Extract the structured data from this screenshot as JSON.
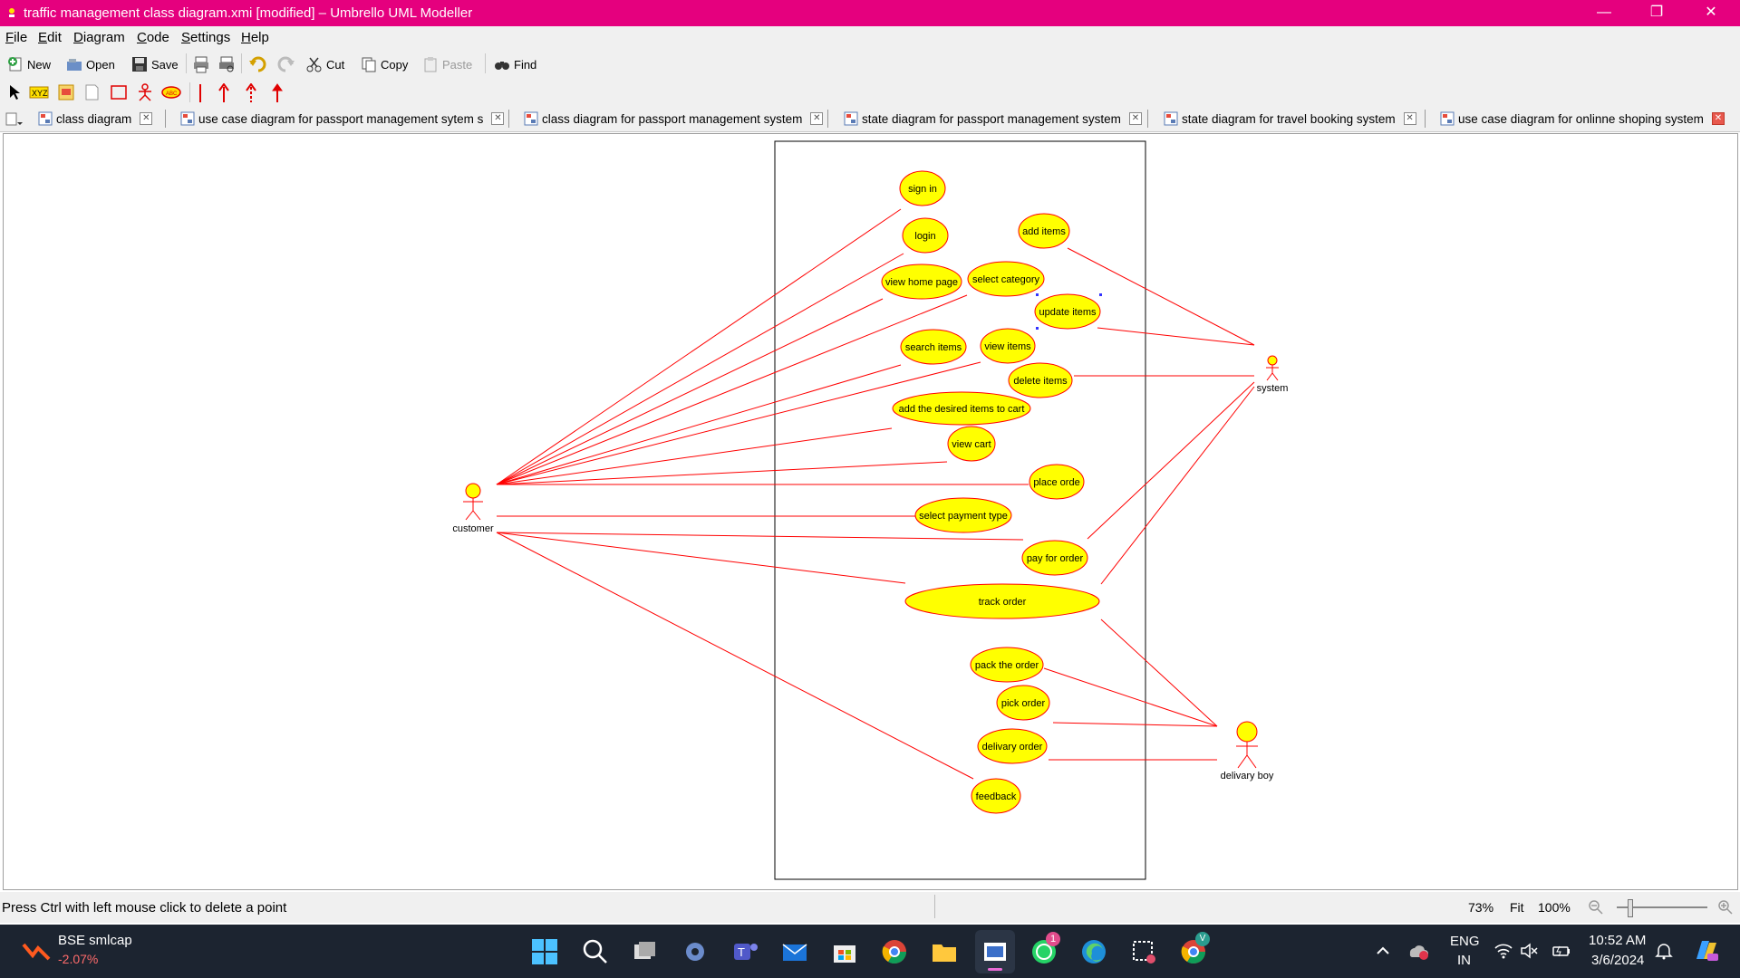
{
  "window": {
    "title": "traffic management class diagram.xmi [modified] – Umbrello UML Modeller",
    "minimize": "—",
    "maximize": "❐",
    "close": "✕"
  },
  "menu": [
    "File",
    "Edit",
    "Diagram",
    "Code",
    "Settings",
    "Help"
  ],
  "toolbar": {
    "new": "New",
    "open": "Open",
    "save": "Save",
    "cut": "Cut",
    "copy": "Copy",
    "paste": "Paste",
    "find": "Find"
  },
  "tabs": [
    "class diagram",
    "use case diagram for passport management sytem s",
    "class diagram for passport management system",
    "state diagram for passport management system",
    "state diagram for travel booking system",
    "use case diagram for onlinne shoping  system"
  ],
  "diagram": {
    "actors": {
      "customer": "customer",
      "system": "system",
      "delivery_boy": "delivary boy"
    },
    "usecases": [
      "sign in",
      "login",
      "add items",
      "view home page",
      "select category",
      "update items",
      "search items",
      "view items",
      "delete items",
      "add the desired items to cart",
      "view cart",
      "place orde",
      "select payment type",
      "pay for order",
      "track order",
      "pack the order",
      "pick order",
      "delivary order",
      "feedback"
    ]
  },
  "status": {
    "message": "Press Ctrl with left mouse click to delete a point",
    "zoom": "73%",
    "fit": "Fit",
    "zoom100": "100%"
  },
  "taskbar": {
    "stock_name": "BSE smlcap",
    "stock_change": "-2.07%",
    "lang1": "ENG",
    "lang2": "IN",
    "time": "10:52 AM",
    "date": "3/6/2024",
    "whatsapp_badge": "1",
    "chrome_badge": "V"
  },
  "colors": {
    "titlebar": "#e5007e",
    "usecase_fill": "#ffff00",
    "line": "#ff0000",
    "taskbar": "#1c2430"
  }
}
